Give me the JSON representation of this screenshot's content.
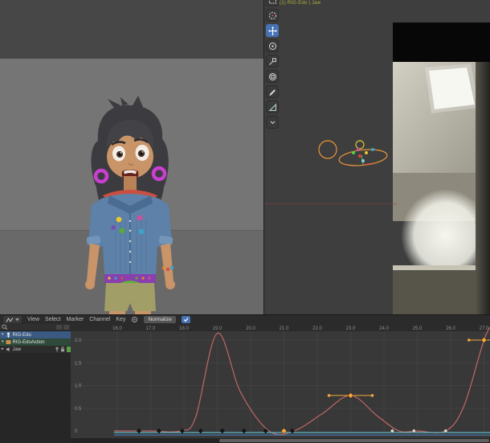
{
  "viewport_right": {
    "info_text": "(1) RIG-Edo | Jaw",
    "tools": [
      "box-select",
      "cursor",
      "move",
      "rotate",
      "scale",
      "transform",
      "annotate",
      "measure",
      "expand"
    ],
    "active_tool": "move",
    "reference": "ceiling-photo-with-light-panel"
  },
  "viewport_left": {
    "content": "character-model-front-view"
  },
  "character": {
    "description": "cartoon girl: dark messy hair, magenta hoop earrings, red neckerchief, blue denim jacket with colored pins, purple studded belt, green pouch, olive shorts"
  },
  "graph_editor": {
    "menus": [
      "View",
      "Select",
      "Marker",
      "Channel",
      "Key"
    ],
    "normalize_label": "Normalize",
    "channels": [
      {
        "label": "RIG-Edo",
        "type": "armature",
        "selected": true
      },
      {
        "label": "RIG-EdoAction",
        "type": "action",
        "selected": false
      },
      {
        "label": "Jaw",
        "type": "channel-group",
        "selected": false
      }
    ],
    "ruler_labels": [
      "16.0",
      "17.0",
      "18.0",
      "19.0",
      "20.0",
      "21.0",
      "22.0",
      "23.0",
      "24.0",
      "25.0",
      "26.0",
      "27.0"
    ],
    "yaxis_labels": [
      "2.0",
      "1.5",
      "1.0",
      "0.5",
      "0"
    ],
    "yaxis_values": [
      2.0,
      1.5,
      1.0,
      0.5,
      0
    ],
    "chart_data": {
      "type": "line",
      "xlabel": "frame",
      "ylabel": "value",
      "x_range": [
        15.9,
        27.3
      ],
      "y_range": [
        -0.15,
        2.35
      ],
      "grid": true,
      "series": [
        {
          "name": "jaw-fcurve",
          "color": "#c06767",
          "points": [
            [
              15.9,
              0
            ],
            [
              17.0,
              0
            ],
            [
              17.9,
              0
            ],
            [
              18.35,
              0.3
            ],
            [
              19.0,
              2.15
            ],
            [
              19.7,
              0.85
            ],
            [
              20.55,
              0
            ],
            [
              21.3,
              0
            ],
            [
              22.15,
              0.38
            ],
            [
              23.0,
              0.78
            ],
            [
              23.8,
              0.33
            ],
            [
              24.45,
              0
            ],
            [
              25.0,
              0
            ],
            [
              25.85,
              0
            ],
            [
              26.4,
              0.55
            ],
            [
              27.0,
              2.0
            ],
            [
              27.3,
              2.4
            ]
          ],
          "keyframes": [
            {
              "frame": 16.65,
              "value": 0,
              "state": "normal"
            },
            {
              "frame": 17.25,
              "value": 0,
              "state": "normal"
            },
            {
              "frame": 17.95,
              "value": 0,
              "state": "normal"
            },
            {
              "frame": 18.5,
              "value": 0,
              "state": "normal"
            },
            {
              "frame": 19.15,
              "value": 0,
              "state": "normal"
            },
            {
              "frame": 19.8,
              "value": 0,
              "state": "normal"
            },
            {
              "frame": 20.45,
              "value": 0,
              "state": "normal"
            },
            {
              "frame": 21.0,
              "value": 0,
              "state": "selected"
            },
            {
              "frame": 21.25,
              "value": 0,
              "state": "normal"
            },
            {
              "frame": 23.0,
              "value": 0.78,
              "state": "selected",
              "handles": [
                [
                  22.35,
                  0.78
                ],
                [
                  23.65,
                  0.78
                ]
              ]
            },
            {
              "frame": 24.25,
              "value": 0,
              "state": "light"
            },
            {
              "frame": 24.9,
              "value": 0,
              "state": "light"
            },
            {
              "frame": 25.85,
              "value": 0,
              "state": "light"
            },
            {
              "frame": 27.0,
              "value": 2.0,
              "state": "selected",
              "handles": [
                [
                  26.55,
                  2.0
                ],
                [
                  27.3,
                  2.0
                ]
              ]
            }
          ]
        },
        {
          "name": "flat-fcurve-cyan",
          "color": "#5fb7c9",
          "points": [
            [
              15.9,
              -0.035
            ],
            [
              27.3,
              -0.035
            ]
          ]
        },
        {
          "name": "flat-fcurve-blue",
          "color": "#4d7fb8",
          "points": [
            [
              15.9,
              -0.09
            ],
            [
              27.3,
              -0.09
            ]
          ]
        }
      ]
    }
  },
  "colors": {
    "accent_blue": "#4772b3",
    "selected_channel_blue": "#3a5a83",
    "action_channel_green": "#2f4a3a",
    "curve_red": "#c06767",
    "curve_cyan": "#5fb7c9",
    "curve_blue": "#4d7fb8",
    "keyframe_selected": "#f5a63b",
    "keyframe_normal": "#141414",
    "keyframe_light": "#d8d6c6",
    "info_text_yellow": "#b3b03c",
    "channel_swatch_green": "#5a9e4a"
  }
}
